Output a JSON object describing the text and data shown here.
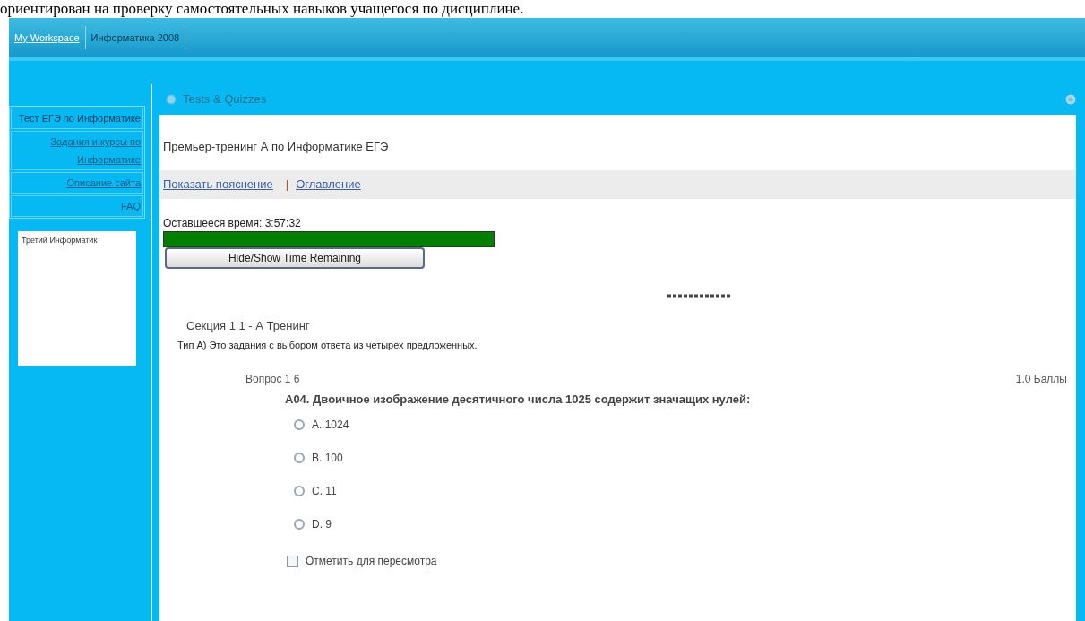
{
  "document_line": "ориентирован на проверку самостоятельных навыков учащегося по дисциплине.",
  "site_tabs": [
    {
      "label": "My Workspace",
      "selected": false
    },
    {
      "label": "Информатика 2008",
      "selected": true
    }
  ],
  "sidebar": {
    "items": [
      {
        "label": "Тест ЕГЭ по Информатике",
        "selected": true
      },
      {
        "label": "Задания и курсы по Информатике",
        "selected": false
      },
      {
        "label": "Описание сайта",
        "selected": false
      },
      {
        "label": "FAQ",
        "selected": false
      }
    ],
    "note": "Третий Информатик"
  },
  "tool": {
    "title": "Tests & Quizzes"
  },
  "quiz": {
    "title": "Премьер-тренинг А по Информатике ЕГЭ",
    "links": [
      "Показать пояснение",
      "Оглавление"
    ],
    "separator": "|",
    "timer": {
      "label": "Оставшееся время: 3:57:32",
      "level": 1.0,
      "button": "Hide/Show Time Remaining"
    },
    "section": {
      "title": "Секция 1 1 - А Тренинг",
      "description": "Тип А) Это задания с выбором ответа из четырех предложенных."
    },
    "question": {
      "number": "Вопрос 1 6",
      "points": "1.0 Баллы",
      "text": "А04. Двоичное изображение десятичного числа 1025 содержит значащих нулей:",
      "options": [
        {
          "label": "A. 1024",
          "selected": false
        },
        {
          "label": "B. 100",
          "selected": false
        },
        {
          "label": "C. 11",
          "selected": false
        },
        {
          "label": "D. 9",
          "selected": false
        }
      ],
      "review": {
        "label": "Отметить для пересмотра",
        "checked": false
      }
    }
  }
}
